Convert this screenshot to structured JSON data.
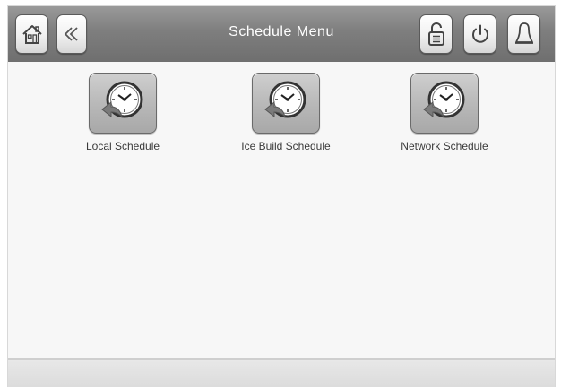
{
  "header": {
    "title": "Schedule Menu",
    "left_buttons": [
      {
        "icon": "home-icon"
      },
      {
        "icon": "chevron-double-left-icon"
      }
    ],
    "right_buttons": [
      {
        "icon": "unlock-icon"
      },
      {
        "icon": "power-icon"
      },
      {
        "icon": "bell-icon"
      }
    ]
  },
  "menu": {
    "items": [
      {
        "label": "Local Schedule",
        "icon": "clock-icon"
      },
      {
        "label": "Ice Build Schedule",
        "icon": "clock-icon"
      },
      {
        "label": "Network Schedule",
        "icon": "clock-icon"
      }
    ]
  },
  "colors": {
    "header_bg": "#7e7e7e",
    "content_bg": "#f7f7f7",
    "tile_bg": "#b9b9b9",
    "title_text": "#ffffff"
  }
}
